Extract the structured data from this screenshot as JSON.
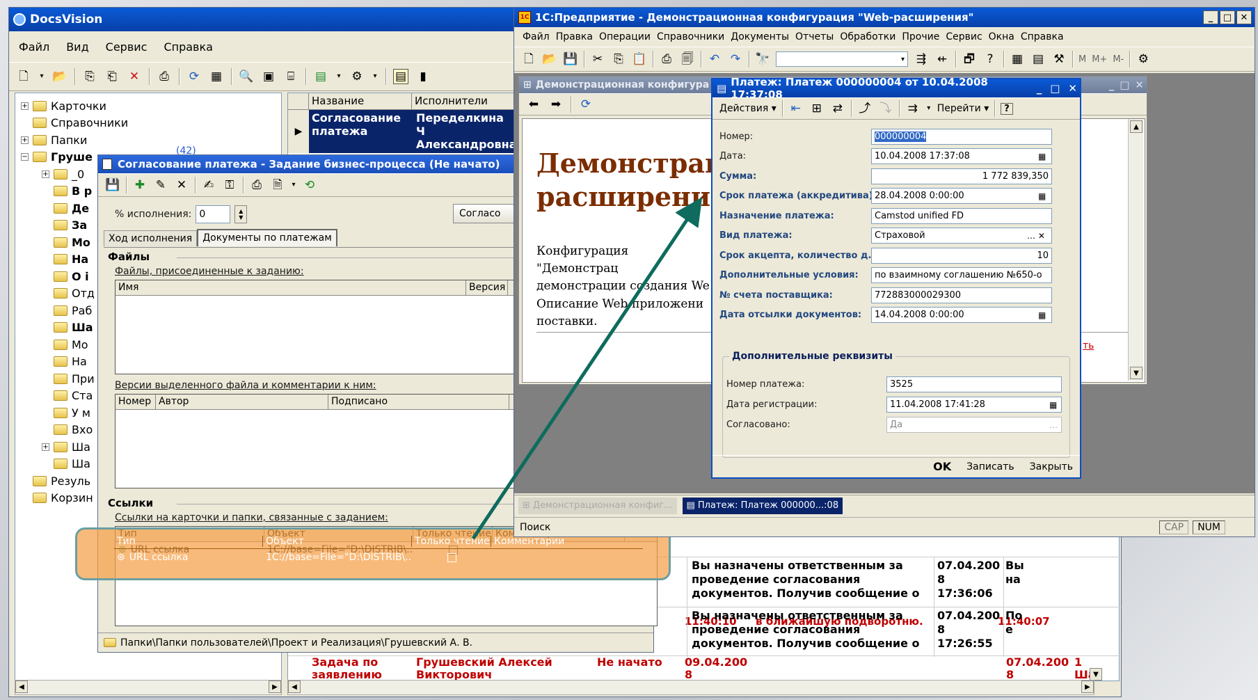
{
  "docsvision": {
    "title": "DocsVision",
    "menu": [
      "Файл",
      "Вид",
      "Сервис",
      "Справка"
    ],
    "tree": [
      {
        "label": "Карточки",
        "level": 0,
        "pm": "+"
      },
      {
        "label": "Справочники",
        "level": 0,
        "pm": ""
      },
      {
        "label": "Папки",
        "level": 0,
        "pm": "+"
      },
      {
        "label": "Груше",
        "level": 0,
        "pm": "−",
        "bold": true
      },
      {
        "label": "_0",
        "level": 1,
        "pm": "+"
      },
      {
        "label": "В р",
        "level": 1,
        "pm": "",
        "bold": true
      },
      {
        "label": "Де",
        "level": 1,
        "pm": "",
        "bold": true
      },
      {
        "label": "За",
        "level": 1,
        "pm": "",
        "bold": true
      },
      {
        "label": "Мо",
        "level": 1,
        "pm": "",
        "bold": true
      },
      {
        "label": "На",
        "level": 1,
        "pm": "",
        "bold": true
      },
      {
        "label": "О і",
        "level": 1,
        "pm": "",
        "bold": true
      },
      {
        "label": "Отд",
        "level": 1,
        "pm": ""
      },
      {
        "label": "Раб",
        "level": 1,
        "pm": ""
      },
      {
        "label": "Ша",
        "level": 1,
        "pm": "",
        "bold": true
      },
      {
        "label": "Мо",
        "level": 1,
        "pm": ""
      },
      {
        "label": "На",
        "level": 1,
        "pm": ""
      },
      {
        "label": "При",
        "level": 1,
        "pm": ""
      },
      {
        "label": "Ста",
        "level": 1,
        "pm": ""
      },
      {
        "label": "У м",
        "level": 1,
        "pm": ""
      },
      {
        "label": "Вхо",
        "level": 1,
        "pm": ""
      },
      {
        "label": "Ша",
        "level": 1,
        "pm": "+"
      },
      {
        "label": "Ша",
        "level": 1,
        "pm": ""
      },
      {
        "label": "Резуль",
        "level": 0,
        "pm": ""
      },
      {
        "label": "Корзин",
        "level": 0,
        "pm": ""
      }
    ],
    "count_badge": "(42)",
    "grid": {
      "col_name": "Название",
      "col_exec": "Исполнители",
      "row1_name": "Согласование платежа",
      "row1_exec": "Переделкина Ч Александровна"
    },
    "bottom_rows": [
      {
        "time": "11:40:10",
        "msg_top": "в ближайшую подворотню.",
        "date_top": "11:40:07"
      },
      {
        "msg": "Вы назначены ответственным за проведение согласования документов. Получив сообщение о",
        "date": "07.04.200 8 17:36:06",
        "extra": "Вы на"
      },
      {
        "msg": "Вы назначены ответственным за проведение согласования документов. Получив сообщение о",
        "date": "07.04.200 8 17:26:55",
        "extra": "По е"
      },
      {
        "name": "Задача по заявлению",
        "exec": "Грушевский Алексей Викторович",
        "status": "Не начато",
        "date1": "09.04.200 8",
        "date2": "07.04.200 8",
        "extra": "1 Ша"
      }
    ]
  },
  "task": {
    "title": "Согласование платежа - Задание бизнес-процесса (Не начато)",
    "progress_label": "% исполнения:",
    "progress_value": "0",
    "agree_button": "Согласо",
    "tabs": [
      "Ход исполнения",
      "Документы по платежам"
    ],
    "files_header": "Файлы",
    "files_caption": "Файлы, присоединенные к заданию:",
    "files_cols": [
      "Имя",
      "Версия"
    ],
    "versions_caption": "Версии выделенного файла и комментарии к ним:",
    "versions_cols": [
      "Номер",
      "Автор",
      "Подписано"
    ],
    "links_header": "Ссылки",
    "links_caption": "Ссылки на карточки и папки, связанные с заданием:",
    "links_cols": [
      "Тип",
      "Объект",
      "Только чтение",
      "Комментарии"
    ],
    "link_type": "URL ссылка",
    "link_object": "1C://base=File=\"D:\\DISTRIB\\...",
    "status_path": "Папки\\Папки пользователей\\Проект и Реализация\\Грушевский А. В."
  },
  "onec": {
    "title": "1С:Предприятие - Демонстрационная конфигурация \"Web-расширения\"",
    "menu": [
      "Файл",
      "Правка",
      "Операции",
      "Справочники",
      "Документы",
      "Отчеты",
      "Обработки",
      "Прочие",
      "Сервис",
      "Окна",
      "Справка"
    ],
    "m_buttons": [
      "M",
      "M+",
      "M-"
    ],
    "inner_title": "Демонстрационная конфигура",
    "demo_heading_line1": "Демонстраци",
    "demo_heading_line2": "расширения\"",
    "demo_text1": "Конфигурация \"Демонстрац демонстрации создания We",
    "demo_text2": "Описание Web-приложени поставки.",
    "link_tail": "ть",
    "taskbar_items": [
      "Демонстрационная конфиг...",
      "Платеж: Платеж 000000...:08"
    ],
    "search_label": "Поиск",
    "status": [
      "CAP",
      "NUM"
    ]
  },
  "payment": {
    "title": "Платеж: Платеж 000000004 от 10.04.2008 17:37:08",
    "toolbar": {
      "actions": "Действия",
      "goto": "Перейти",
      "help": "?"
    },
    "fields": [
      {
        "label": "Номер:",
        "value": "000000004",
        "bold": false,
        "selected": true
      },
      {
        "label": "Дата:",
        "value": "10.04.2008 17:37:08",
        "bold": false,
        "btn": "cal"
      },
      {
        "label": "Сумма:",
        "value": "1 772 839,350",
        "bold": true,
        "align": "right"
      },
      {
        "label": "Срок платежа (аккредитива):",
        "value": "28.04.2008  0:00:00",
        "bold": true,
        "btn": "cal"
      },
      {
        "label": "Назначение платежа:",
        "value": "Camstod unified FD",
        "bold": true
      },
      {
        "label": "Вид платежа:",
        "value": "Страховой",
        "bold": true,
        "btn": "sel"
      },
      {
        "label": "Срок акцепта, количество д...",
        "value": "10",
        "bold": true,
        "align": "right"
      },
      {
        "label": "Дополнительные условия:",
        "value": "по взаимному соглашению №650-о",
        "bold": true
      },
      {
        "label": "№ счета поставщика:",
        "value": "772883000029300",
        "bold": true
      },
      {
        "label": "Дата отсылки документов:",
        "value": "14.04.2008  0:00:00",
        "bold": true,
        "btn": "cal"
      }
    ],
    "group_title": "Дополнительные реквизиты",
    "group_fields": [
      {
        "label": "Номер платежа:",
        "value": "3525"
      },
      {
        "label": "Дата регистрации:",
        "value": "11.04.2008 17:41:28",
        "btn": "cal"
      },
      {
        "label": "Согласовано:",
        "value": "Да",
        "btn": "dots",
        "disabled": true
      }
    ],
    "buttons": {
      "ok": "OK",
      "save": "Записать",
      "close": "Закрыть"
    }
  },
  "colors": {
    "arrow": "#0e6b5e",
    "highlight": "#f5a64a",
    "title_active": "#0a5ad6"
  }
}
